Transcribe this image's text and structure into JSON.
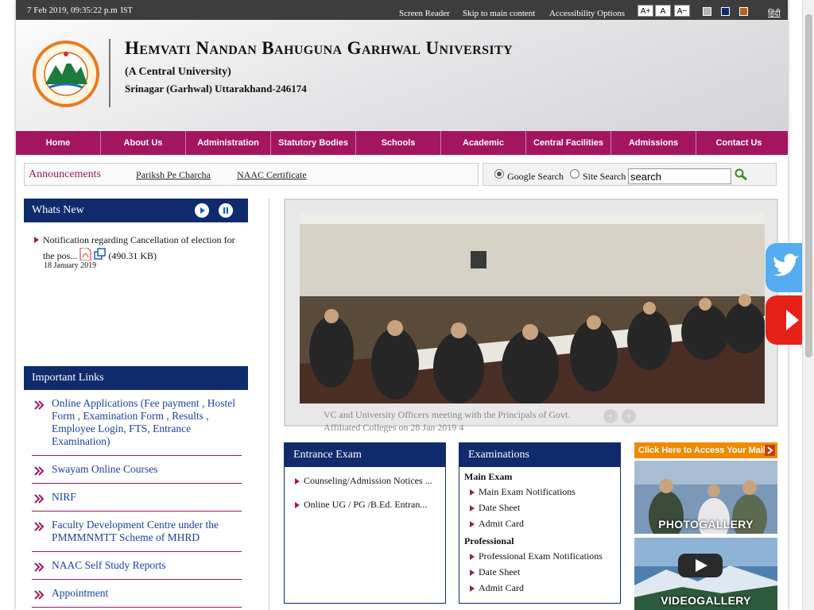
{
  "topbar": {
    "datetime": "7 Feb 2019, 09:35:22 p.m",
    "tz": "IST",
    "links": [
      "Screen Reader",
      "Skip to main content",
      "Accessibility Options"
    ],
    "font_buttons": [
      "A+",
      "A",
      "A−"
    ],
    "themes": [
      "#b5b5b5",
      "#0f2b6b",
      "#b8621b"
    ],
    "language": "हिंदी"
  },
  "header": {
    "university_name": "Hemvati Nandan Bahuguna Garhwal University",
    "subtitle": "(A Central University)",
    "address": "Srinagar (Garhwal) Uttarakhand-246174"
  },
  "nav": [
    "Home",
    "About Us",
    "Administration",
    "Statutory Bodies",
    "Schools",
    "Academic",
    "Central Facilities",
    "Admissions",
    "Contact Us"
  ],
  "announcements": {
    "label": "Announcements",
    "items": [
      "Pariksh Pe Charcha",
      "NAAC Certificate"
    ]
  },
  "search": {
    "options": [
      "Google Search",
      "Site Search"
    ],
    "selected": "Google Search",
    "value": "search"
  },
  "whats_new": {
    "title": "Whats New",
    "item": "Notification regarding Cancellation of election for the pos...",
    "size": "(490.31 KB)",
    "date": "18 January 2019"
  },
  "important_links": {
    "title": "Important Links",
    "items": [
      "Online Applications (Fee payment , Hostel Form , Examination Form , Results , Employee Login, FTS, Entrance Examination)",
      "Swayam Online Courses",
      "NIRF",
      "Faculty Development Centre under the PMMMNMTT Scheme of MHRD",
      "NAAC Self Study Reports",
      "Appointment"
    ]
  },
  "slider": {
    "caption": "VC and University Officers meeting with the Principals of Govt. Affiliated Colleges on 28 Jan 2019 4"
  },
  "entrance_exam": {
    "title": "Entrance Exam",
    "items": [
      "Counseling/Admission Notices ...",
      "Online UG / PG /B.Ed. Entran..."
    ]
  },
  "examinations": {
    "title": "Examinations",
    "main_heading": "Main Exam",
    "main_items": [
      "Main Exam Notifications",
      "Date Sheet",
      "Admit Card"
    ],
    "prof_heading": "Professional",
    "prof_items": [
      "Professional Exam Notifications",
      "Date Sheet",
      "Admit Card"
    ]
  },
  "side": {
    "mail": "Click Here to Access Your Mail",
    "photogallery": "PHOTOGALLERY",
    "videogallery": "VIDEOGALLERY"
  },
  "colors": {
    "nav": "#a3155f",
    "panel_header": "#0f2b6b",
    "mail_button": "#f08a00",
    "twitter": "#55acee",
    "youtube": "#e62117"
  }
}
